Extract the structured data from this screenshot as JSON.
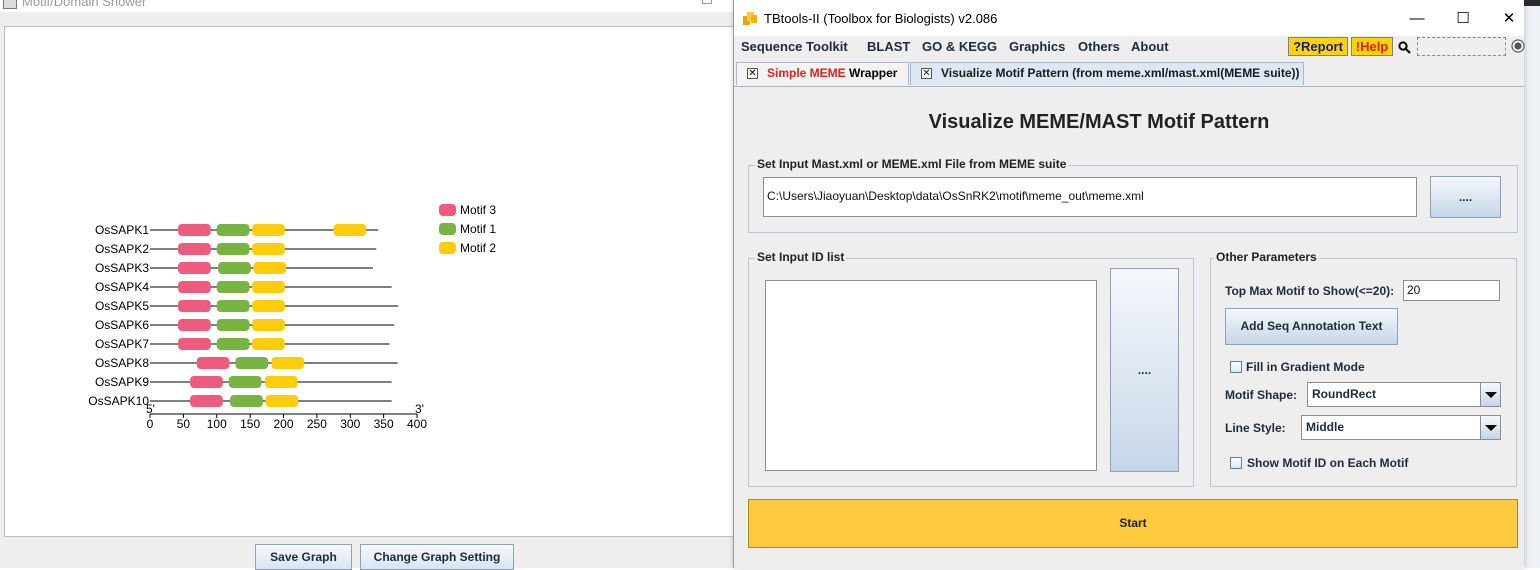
{
  "left_window": {
    "title": "Motif/Domain Shower",
    "buttons": {
      "save": "Save Graph",
      "change_setting": "Change Graph Setting"
    }
  },
  "chart_data": {
    "type": "motif-pattern",
    "xlim": [
      0,
      400
    ],
    "ticks": [
      0,
      50,
      100,
      150,
      200,
      250,
      300,
      350,
      400
    ],
    "tick_labels": [
      "0",
      "50",
      "100",
      "150",
      "200",
      "250",
      "300",
      "350",
      "400"
    ],
    "axis_end_labels": [
      "5'",
      "3'"
    ],
    "legend": [
      {
        "name": "Motif 3",
        "color": "#ef5b7e"
      },
      {
        "name": "Motif 1",
        "color": "#77b441"
      },
      {
        "name": "Motif 2",
        "color": "#fdcd0b"
      }
    ],
    "sequences": [
      {
        "name": "OsSAPK1",
        "length": 342,
        "motifs": [
          {
            "motif": "Motif 3",
            "start": 42,
            "end": 91
          },
          {
            "motif": "Motif 1",
            "start": 100,
            "end": 149
          },
          {
            "motif": "Motif 2",
            "start": 153,
            "end": 202
          },
          {
            "motif": "Motif 2",
            "start": 275,
            "end": 324
          }
        ]
      },
      {
        "name": "OsSAPK2",
        "length": 339,
        "motifs": [
          {
            "motif": "Motif 3",
            "start": 42,
            "end": 91
          },
          {
            "motif": "Motif 1",
            "start": 100,
            "end": 149
          },
          {
            "motif": "Motif 2",
            "start": 153,
            "end": 202
          }
        ]
      },
      {
        "name": "OsSAPK3",
        "length": 334,
        "motifs": [
          {
            "motif": "Motif 3",
            "start": 42,
            "end": 91
          },
          {
            "motif": "Motif 1",
            "start": 102,
            "end": 151
          },
          {
            "motif": "Motif 2",
            "start": 155,
            "end": 204
          }
        ]
      },
      {
        "name": "OsSAPK4",
        "length": 362,
        "motifs": [
          {
            "motif": "Motif 3",
            "start": 42,
            "end": 91
          },
          {
            "motif": "Motif 1",
            "start": 100,
            "end": 149
          },
          {
            "motif": "Motif 2",
            "start": 153,
            "end": 202
          }
        ]
      },
      {
        "name": "OsSAPK5",
        "length": 372,
        "motifs": [
          {
            "motif": "Motif 3",
            "start": 42,
            "end": 91
          },
          {
            "motif": "Motif 1",
            "start": 100,
            "end": 149
          },
          {
            "motif": "Motif 2",
            "start": 153,
            "end": 202
          }
        ]
      },
      {
        "name": "OsSAPK6",
        "length": 366,
        "motifs": [
          {
            "motif": "Motif 3",
            "start": 42,
            "end": 91
          },
          {
            "motif": "Motif 1",
            "start": 100,
            "end": 149
          },
          {
            "motif": "Motif 2",
            "start": 153,
            "end": 202
          }
        ]
      },
      {
        "name": "OsSAPK7",
        "length": 359,
        "motifs": [
          {
            "motif": "Motif 3",
            "start": 42,
            "end": 91
          },
          {
            "motif": "Motif 1",
            "start": 100,
            "end": 149
          },
          {
            "motif": "Motif 2",
            "start": 153,
            "end": 202
          }
        ]
      },
      {
        "name": "OsSAPK8",
        "length": 371,
        "motifs": [
          {
            "motif": "Motif 3",
            "start": 70,
            "end": 119
          },
          {
            "motif": "Motif 1",
            "start": 128,
            "end": 177
          },
          {
            "motif": "Motif 2",
            "start": 182,
            "end": 231
          }
        ]
      },
      {
        "name": "OsSAPK9",
        "length": 362,
        "motifs": [
          {
            "motif": "Motif 3",
            "start": 60,
            "end": 109
          },
          {
            "motif": "Motif 1",
            "start": 118,
            "end": 167
          },
          {
            "motif": "Motif 2",
            "start": 172,
            "end": 221
          }
        ]
      },
      {
        "name": "OsSAPK10",
        "length": 362,
        "motifs": [
          {
            "motif": "Motif 3",
            "start": 60,
            "end": 109
          },
          {
            "motif": "Motif 1",
            "start": 120,
            "end": 169
          },
          {
            "motif": "Motif 2",
            "start": 173,
            "end": 222
          }
        ]
      }
    ]
  },
  "app": {
    "title": "TBtools-II (Toolbox for Biologists) v2.086",
    "window_controls": {
      "minimize": "—",
      "maximize": "☐",
      "close": "✕"
    },
    "menu": [
      "Sequence Toolkit",
      "BLAST",
      "GO & KEGG",
      "Graphics",
      "Others",
      "About"
    ],
    "report_label": "?Report",
    "help_label": "!Help",
    "search_value": "",
    "tabs": [
      {
        "label_red": "Simple MEME",
        "label_rest": " Wrapper",
        "close": "✕"
      },
      {
        "label": "Visualize Motif Pattern (from meme.xml/mast.xml(MEME suite))",
        "close": "✕"
      }
    ],
    "main_title": "Visualize MEME/MAST Motif Pattern",
    "input_file": {
      "group_label": "Set Input Mast.xml or MEME.xml File from MEME suite",
      "path": "C:\\Users\\Jiaoyuan\\Desktop\\data\\OsSnRK2\\motif\\meme_out\\meme.xml",
      "browse_label": "...."
    },
    "id_list": {
      "group_label": "Set Input ID list",
      "value": "",
      "browse_label": "...."
    },
    "params": {
      "group_label": "Other Parameters",
      "top_max_label": "Top Max Motif to Show(<=20):",
      "top_max_value": "20",
      "add_annot_label": "Add Seq Annotation Text",
      "gradient_label": "Fill in Gradient Mode",
      "gradient_checked": false,
      "shape_label": "Motif Shape:",
      "shape_value": "RoundRect",
      "line_label": "Line Style:",
      "line_value": "Middle",
      "show_id_label": "Show Motif ID on Each Motif",
      "show_id_checked": false
    },
    "start_label": "Start",
    "colors": {
      "accent_yellow": "#fdcb3d",
      "report_red": "#e0211b",
      "help_red": "#e0211b",
      "tab_active": "#dde8f4"
    }
  }
}
